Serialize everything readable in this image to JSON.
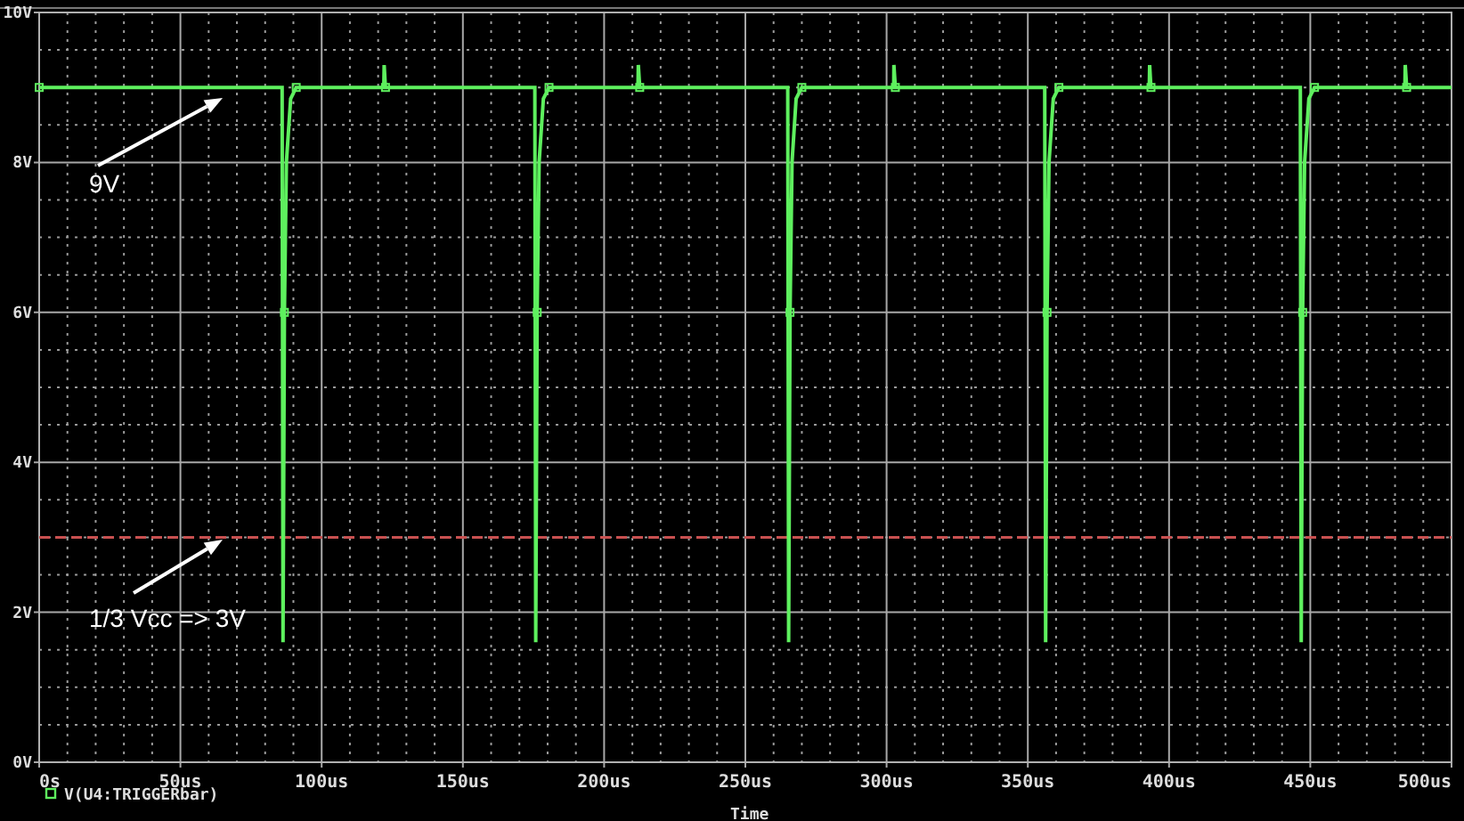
{
  "chart": {
    "chart_data": {
      "type": "line",
      "xlabel": "Time",
      "x": [
        0,
        86,
        86.3,
        86.8,
        87.5,
        89,
        91,
        122,
        122.1,
        122.6,
        175.5,
        175.8,
        176.3,
        177,
        178.5,
        180.5,
        212,
        212.1,
        212.6,
        265,
        265.3,
        265.8,
        266.5,
        268,
        270,
        302.5,
        302.6,
        303.1,
        356,
        356.3,
        356.8,
        357.5,
        359,
        361,
        393,
        393.1,
        393.6,
        446.5,
        446.8,
        447.3,
        448,
        449.5,
        451.5,
        483.5,
        483.6,
        484.1,
        500
      ],
      "series": [
        {
          "name": "V(U4:TRIGGERbar)",
          "color": "#5ef05e",
          "values": [
            9,
            9,
            1.6,
            6,
            8,
            8.85,
            9,
            9,
            9.3,
            9,
            9,
            1.6,
            6,
            8,
            8.85,
            9,
            9,
            9.3,
            9,
            9,
            1.6,
            6,
            8,
            8.85,
            9,
            9,
            9.3,
            9,
            9,
            1.6,
            6,
            8,
            8.85,
            9,
            9,
            9.3,
            9,
            9,
            1.6,
            6,
            8,
            8.85,
            9,
            9,
            9.3,
            9,
            9
          ]
        }
      ],
      "xlim": [
        0,
        500
      ],
      "ylim": [
        0,
        10
      ],
      "xticks": [
        {
          "value": 0,
          "label": "0s"
        },
        {
          "value": 50,
          "label": "50us"
        },
        {
          "value": 100,
          "label": "100us"
        },
        {
          "value": 150,
          "label": "150us"
        },
        {
          "value": 200,
          "label": "200us"
        },
        {
          "value": 250,
          "label": "250us"
        },
        {
          "value": 300,
          "label": "300us"
        },
        {
          "value": 350,
          "label": "350us"
        },
        {
          "value": 400,
          "label": "400us"
        },
        {
          "value": 450,
          "label": "450us"
        },
        {
          "value": 500,
          "label": "500us"
        }
      ],
      "yticks": [
        {
          "value": 0,
          "label": "0V"
        },
        {
          "value": 2,
          "label": "2V"
        },
        {
          "value": 4,
          "label": "4V"
        },
        {
          "value": 6,
          "label": "6V"
        },
        {
          "value": 8,
          "label": "8V"
        },
        {
          "value": 10,
          "label": "10V"
        }
      ],
      "grid": true,
      "ref_lines": [
        {
          "axis": "y",
          "value": 3,
          "color": "#c85050"
        }
      ],
      "annotations": [
        "9V",
        "1/3 Vcc => 3V"
      ]
    }
  }
}
